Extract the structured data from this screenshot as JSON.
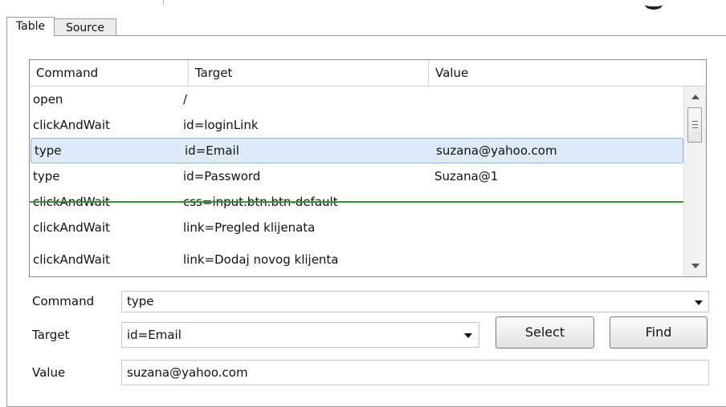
{
  "tabs": [
    {
      "label": "Table",
      "active": true
    },
    {
      "label": "Source",
      "active": false
    }
  ],
  "table": {
    "headers": [
      "Command",
      "Target",
      "Value"
    ],
    "rows": [
      [
        "open",
        "/",
        ""
      ],
      [
        "clickAndWait",
        "id=loginLink",
        ""
      ],
      [
        "type",
        "id=Email",
        "suzana@yahoo.com"
      ],
      [
        "type",
        "id=Password",
        "Suzana@1"
      ],
      [
        "clickAndWait",
        "css=input.btn.btn-default",
        ""
      ],
      [
        "clickAndWait",
        "link=Pregled klijenata",
        ""
      ],
      [
        "clickAndWait",
        "link=Dodaj novog klijenta",
        ""
      ]
    ],
    "selected_row": 2
  },
  "editor": {
    "command_label": "Command",
    "command_value": "type",
    "target_label": "Target",
    "target_value": "id=Email",
    "value_label": "Value",
    "value_value": "suzana@yahoo.com",
    "select_button": "Select",
    "find_button": "Find"
  },
  "icons": {
    "scroll_up": "chevron-up-icon",
    "scroll_down": "chevron-down-icon",
    "dropdown": "caret-down-icon"
  },
  "colors": {
    "selected_row_bg": "#dfeaf8",
    "selected_row_border": "#8fb3dd",
    "drop_indicator": "#3a8f3a"
  }
}
